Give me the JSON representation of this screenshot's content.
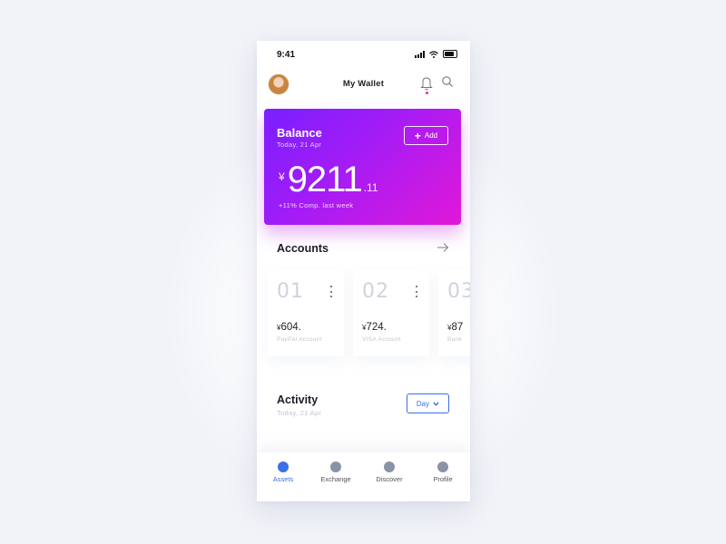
{
  "status_bar": {
    "time": "9:41"
  },
  "header": {
    "title": "My Wallet"
  },
  "balance": {
    "title": "Balance",
    "date": "Today, 21 Apr",
    "add_label": "Add",
    "currency": "¥",
    "amount_int": "9211",
    "amount_dec": ".11",
    "comparison": "+11% Comp. last week"
  },
  "accounts": {
    "title": "Accounts",
    "items": [
      {
        "number": "01",
        "currency": "¥",
        "amount": "604.",
        "label": "PayPal Account"
      },
      {
        "number": "02",
        "currency": "¥",
        "amount": "724.",
        "label": "VISA Account"
      },
      {
        "number": "03",
        "currency": "¥",
        "amount": "87",
        "label": "Bank"
      }
    ]
  },
  "activity": {
    "title": "Activity",
    "date": "Today, 21 Apr",
    "period": "Day"
  },
  "tabs": [
    {
      "label": "Assets",
      "icon": "assets-icon",
      "active": true
    },
    {
      "label": "Exchange",
      "icon": "exchange-icon",
      "active": false
    },
    {
      "label": "Discover",
      "icon": "discover-icon",
      "active": false
    },
    {
      "label": "Profile",
      "icon": "profile-icon",
      "active": false
    }
  ],
  "colors": {
    "accent": "#3a6fe8",
    "card_gradient_start": "#7a1fff",
    "card_gradient_end": "#e118d8",
    "notification_dot": "#e62fa8"
  }
}
